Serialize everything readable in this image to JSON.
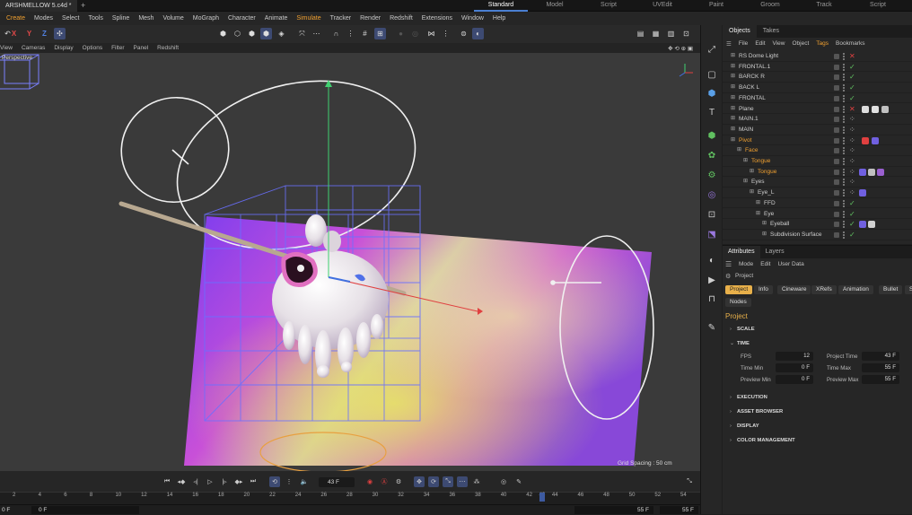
{
  "document_tab": "ARSHMELLOW 5.c4d *",
  "new_tab_symbol": "+",
  "layouts": [
    "Standard",
    "Model",
    "Script",
    "UVEdit",
    "Paint",
    "Groom",
    "Track",
    "Script"
  ],
  "menu": [
    "Create",
    "Modes",
    "Select",
    "Tools",
    "Spline",
    "Mesh",
    "Volume",
    "MoGraph",
    "Character",
    "Animate",
    "Simulate",
    "Tracker",
    "Render",
    "Redshift",
    "Extensions",
    "Window",
    "Help"
  ],
  "axis_buttons": [
    "X",
    "Y",
    "Z"
  ],
  "viewport_menu": [
    "View",
    "Cameras",
    "Display",
    "Options",
    "Filter",
    "Panel",
    "Redshift"
  ],
  "viewport_label": "Perspective",
  "grid_spacing": "Grid Spacing : 50 cm",
  "objects": {
    "tabs": [
      "Objects",
      "Takes"
    ],
    "menu": [
      "File",
      "Edit",
      "View",
      "Object",
      "Tags",
      "Bookmarks"
    ],
    "items": [
      {
        "name": "RS Dome Light",
        "indent": 0,
        "color": "normal",
        "status": "cross"
      },
      {
        "name": "FRONTAL.1",
        "indent": 0,
        "color": "normal",
        "status": "check"
      },
      {
        "name": "BARCK R",
        "indent": 0,
        "color": "normal",
        "status": "check"
      },
      {
        "name": "BACK L",
        "indent": 0,
        "color": "normal",
        "status": "check"
      },
      {
        "name": "FRONTAL",
        "indent": 0,
        "color": "normal",
        "status": "check"
      },
      {
        "name": "Plane",
        "indent": 0,
        "color": "normal",
        "status": "cross"
      },
      {
        "name": "MAIN.1",
        "indent": 0,
        "color": "normal",
        "status": "dots"
      },
      {
        "name": "MAIN",
        "indent": 0,
        "color": "normal",
        "status": "dots"
      },
      {
        "name": "Pivot",
        "indent": 0,
        "color": "orange",
        "status": "dots"
      },
      {
        "name": "Face",
        "indent": 1,
        "color": "orange",
        "status": "dots"
      },
      {
        "name": "Tongue",
        "indent": 2,
        "color": "orange",
        "status": "dots"
      },
      {
        "name": "Tongue",
        "indent": 3,
        "color": "orange",
        "status": "dots"
      },
      {
        "name": "Eyes",
        "indent": 2,
        "color": "normal",
        "status": "dots"
      },
      {
        "name": "Eye_L",
        "indent": 3,
        "color": "normal",
        "status": "dots"
      },
      {
        "name": "FFD",
        "indent": 4,
        "color": "normal",
        "status": "check"
      },
      {
        "name": "Eye",
        "indent": 4,
        "color": "normal",
        "status": "check"
      },
      {
        "name": "Eyeball",
        "indent": 5,
        "color": "normal",
        "status": "check"
      },
      {
        "name": "Subdivision Surface",
        "indent": 5,
        "color": "normal",
        "status": "check"
      }
    ]
  },
  "attributes": {
    "tabs": [
      "Attributes",
      "Layers"
    ],
    "menu": [
      "Mode",
      "Edit",
      "User Data"
    ],
    "path": "Project",
    "buttons": [
      "Project",
      "Info",
      "Cineware",
      "XRefs",
      "Animation",
      "Bullet",
      "Si"
    ],
    "buttons_row2": [
      "Nodes"
    ],
    "heading": "Project",
    "sections": [
      "SCALE",
      "TIME",
      "EXECUTION",
      "ASSET BROWSER",
      "DISPLAY",
      "COLOR MANAGEMENT"
    ],
    "time_fields": [
      {
        "label": "FPS",
        "value": "12"
      },
      {
        "label": "Project Time",
        "value": "43 F"
      },
      {
        "label": "Time Min",
        "value": "0 F"
      },
      {
        "label": "Time Max",
        "value": "55 F"
      },
      {
        "label": "Preview Min",
        "value": "0 F"
      },
      {
        "label": "Preview Max",
        "value": "55 F"
      }
    ]
  },
  "timeline": {
    "current_frame": "43 F",
    "ruler_ticks": [
      "2",
      "4",
      "6",
      "8",
      "10",
      "12",
      "14",
      "16",
      "18",
      "20",
      "22",
      "24",
      "26",
      "28",
      "30",
      "32",
      "34",
      "36",
      "38",
      "40",
      "42",
      "43",
      "44",
      "46",
      "48",
      "50",
      "52",
      "54"
    ],
    "playhead_frame": 43,
    "field_start": "0 F",
    "field_min": "0 F",
    "field_max": "55 F",
    "field_end": "55 F"
  },
  "colors": {
    "accent_orange": "#f0a030",
    "selection_blue": "#3d4a72",
    "active_button": "#e8b04a",
    "check_green": "#60c060",
    "cross_red": "#e04040"
  }
}
